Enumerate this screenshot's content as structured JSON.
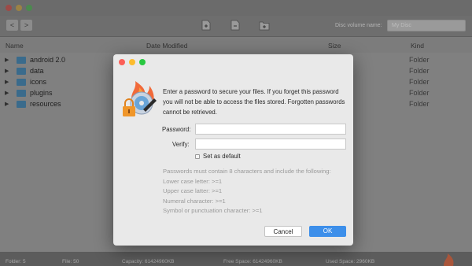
{
  "toolbar": {
    "back_glyph": "<",
    "forward_glyph": ">",
    "disc_volume_label": "Disc volume name:",
    "disc_volume_placeholder": "My Disc"
  },
  "columns": {
    "name": "Name",
    "date": "Date Modified",
    "size": "Size",
    "kind": "Kind"
  },
  "rows": [
    {
      "name": "android 2.0",
      "kind": "Folder"
    },
    {
      "name": "data",
      "kind": "Folder"
    },
    {
      "name": "icons",
      "kind": "Folder"
    },
    {
      "name": "plugins",
      "kind": "Folder"
    },
    {
      "name": "resources",
      "kind": "Folder"
    }
  ],
  "status": {
    "folder": "Folder: 5",
    "file": "File: 50",
    "capacity": "Capacity: 61424960KB",
    "free": "Free Space: 61424960KB",
    "used": "Used Space: 2960KB"
  },
  "dialog": {
    "message": "Enter a password to secure your files. If you forget this password you will not be able to access the files stored. Forgotten passwords cannot be retrieved.",
    "password_label": "Password:",
    "verify_label": "Verify:",
    "set_default_label": "Set as default",
    "set_default_checked": false,
    "rules": [
      "Passwords must contain 8 characters and include the following:",
      "Lower case letter: >=1",
      "Upper case latter: >=1",
      "Numeral character: >=1",
      "Symbol or punctuation character: >=1"
    ],
    "cancel_label": "Cancel",
    "ok_label": "OK"
  },
  "icons": {
    "window_close": "close-icon",
    "window_minimize": "minimize-icon",
    "window_zoom": "zoom-icon",
    "add_file": "add-file-icon",
    "remove_file": "remove-file-icon",
    "add_folder": "add-folder-icon",
    "folder": "folder-icon",
    "app_logo": "burning-disc-lock-icon"
  },
  "colors": {
    "close_red": "#fc5f57",
    "minimize_yellow": "#fdbc2e",
    "zoom_green": "#28c840",
    "ok_blue": "#3d8fea",
    "folder_blue": "#3a6b8c"
  }
}
